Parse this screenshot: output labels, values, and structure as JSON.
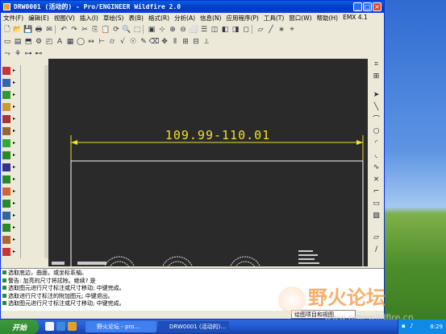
{
  "window": {
    "title": "DRW0001 (活动的) - Pro/ENGINEER Wildfire 2.0",
    "controls": {
      "minimize": "_",
      "maximize": "□",
      "close": "×"
    }
  },
  "menu": [
    "文件(F)",
    "编辑(E)",
    "视图(V)",
    "插入(I)",
    "草绘(S)",
    "表(B)",
    "格式(R)",
    "分析(A)",
    "信息(N)",
    "应用程序(P)",
    "工具(T)",
    "窗口(W)",
    "帮助(H)",
    "EMX 4.1"
  ],
  "canvas": {
    "dimension_text": "109.99-110.01",
    "background": "#2a2a2a",
    "dimension_color": "#f0e030",
    "geometry_color": "#ffffff"
  },
  "messages": [
    "选取底边，曲面，或坐标系轴。",
    "警告: 加亮的尺寸将拭除。继续?   是",
    "选取图元进行尺寸标注或尺寸移动; 中键完成。",
    "选取进行尺寸标注的附加图元; 中键退出。",
    "选取图元进行尺寸标注或尺寸移动; 中键完成。"
  ],
  "status_field": "绘图项目和视图",
  "watermark": {
    "title": "野火论坛",
    "url": "www.proewildfire.cn"
  },
  "taskbar": {
    "start_label": "开始",
    "tasks": [
      {
        "label": "野火论坛 - pro...",
        "active": false
      },
      {
        "label": "DRW0001 (活动的)...",
        "active": true
      }
    ],
    "clock": "8:29"
  }
}
